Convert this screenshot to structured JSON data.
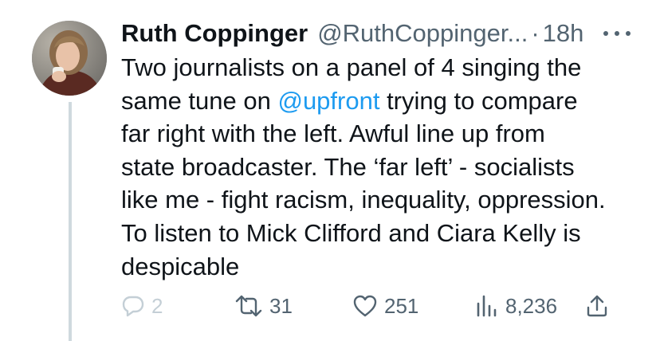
{
  "tweet": {
    "author_name": "Ruth Coppinger",
    "author_handle": "@RuthCoppinger...",
    "separator": "·",
    "time_ago": "18h",
    "text_before_mention": "Two journalists on a panel of 4 singing the\nsame tune on ",
    "mention": "@upfront",
    "text_after_mention": " trying to compare\nfar right with the left. Awful line up from\nstate broadcaster. The ‘far left’ - socialists\nlike me - fight racism, inequality, oppression.\nTo listen to Mick Clifford and Ciara Kelly is\ndespicable"
  },
  "actions": {
    "replies": "2",
    "retweets": "31",
    "likes": "251",
    "views": "8,236"
  },
  "icons": {
    "more": "more-dots-icon",
    "reply": "reply-bubble-icon",
    "retweet": "retweet-icon",
    "like": "heart-icon",
    "views": "views-bar-chart-icon",
    "share": "share-upload-icon"
  },
  "colors": {
    "text": "#0f1419",
    "secondary": "#536471",
    "mention": "#1d9bf0",
    "thread_line": "#cfd9de",
    "reply_disabled": "#c4cfd6"
  }
}
